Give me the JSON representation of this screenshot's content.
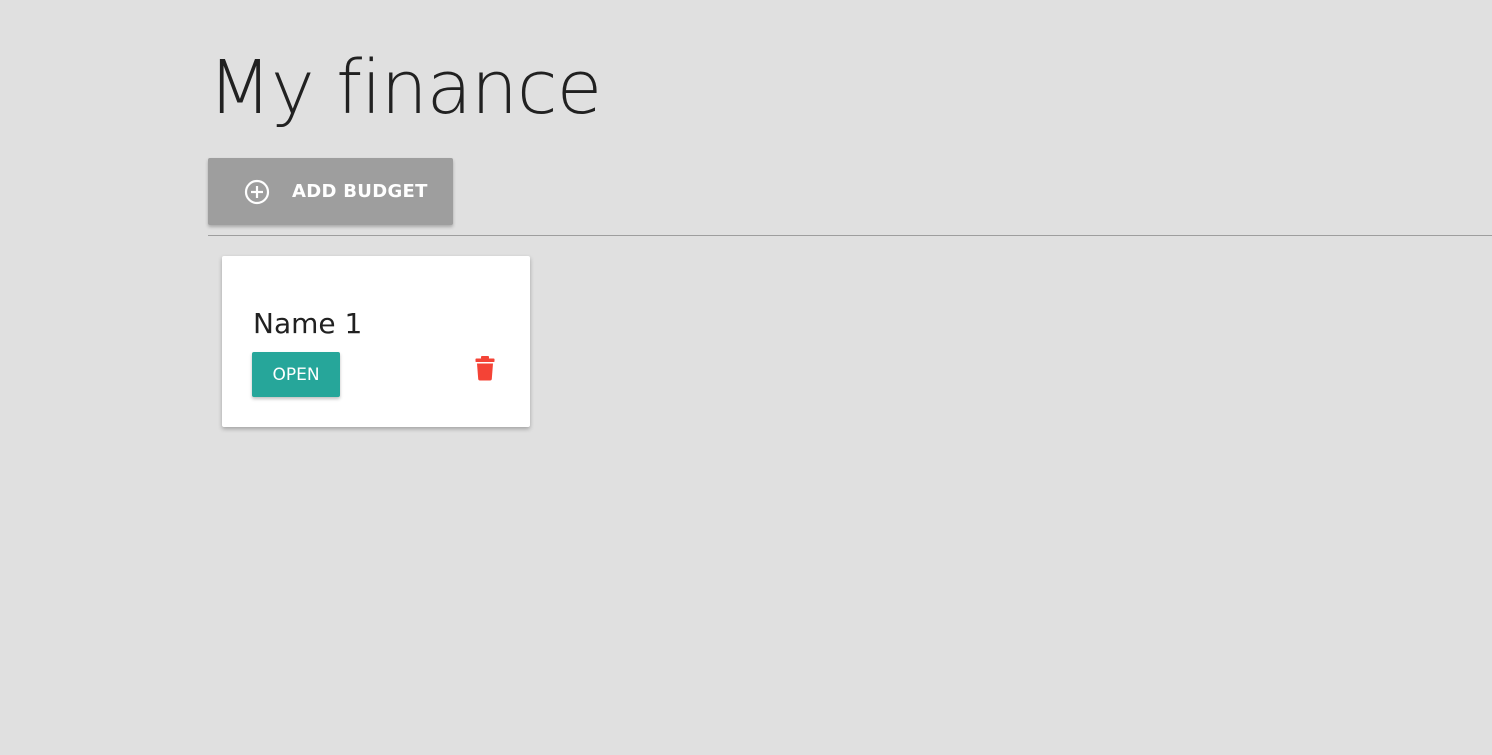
{
  "page": {
    "title": "My finance"
  },
  "toolbar": {
    "add_budget_label": "ADD BUDGET",
    "add_budget_icon": "add-circle-outline-icon"
  },
  "budgets": [
    {
      "name": "Name 1",
      "open_label": "OPEN",
      "delete_icon": "trash-icon"
    }
  ],
  "colors": {
    "background": "#e0e0e0",
    "add_button": "#9e9e9e",
    "open_button": "#26a69a",
    "delete_icon": "#f44336",
    "card": "#ffffff",
    "text": "#212121"
  }
}
